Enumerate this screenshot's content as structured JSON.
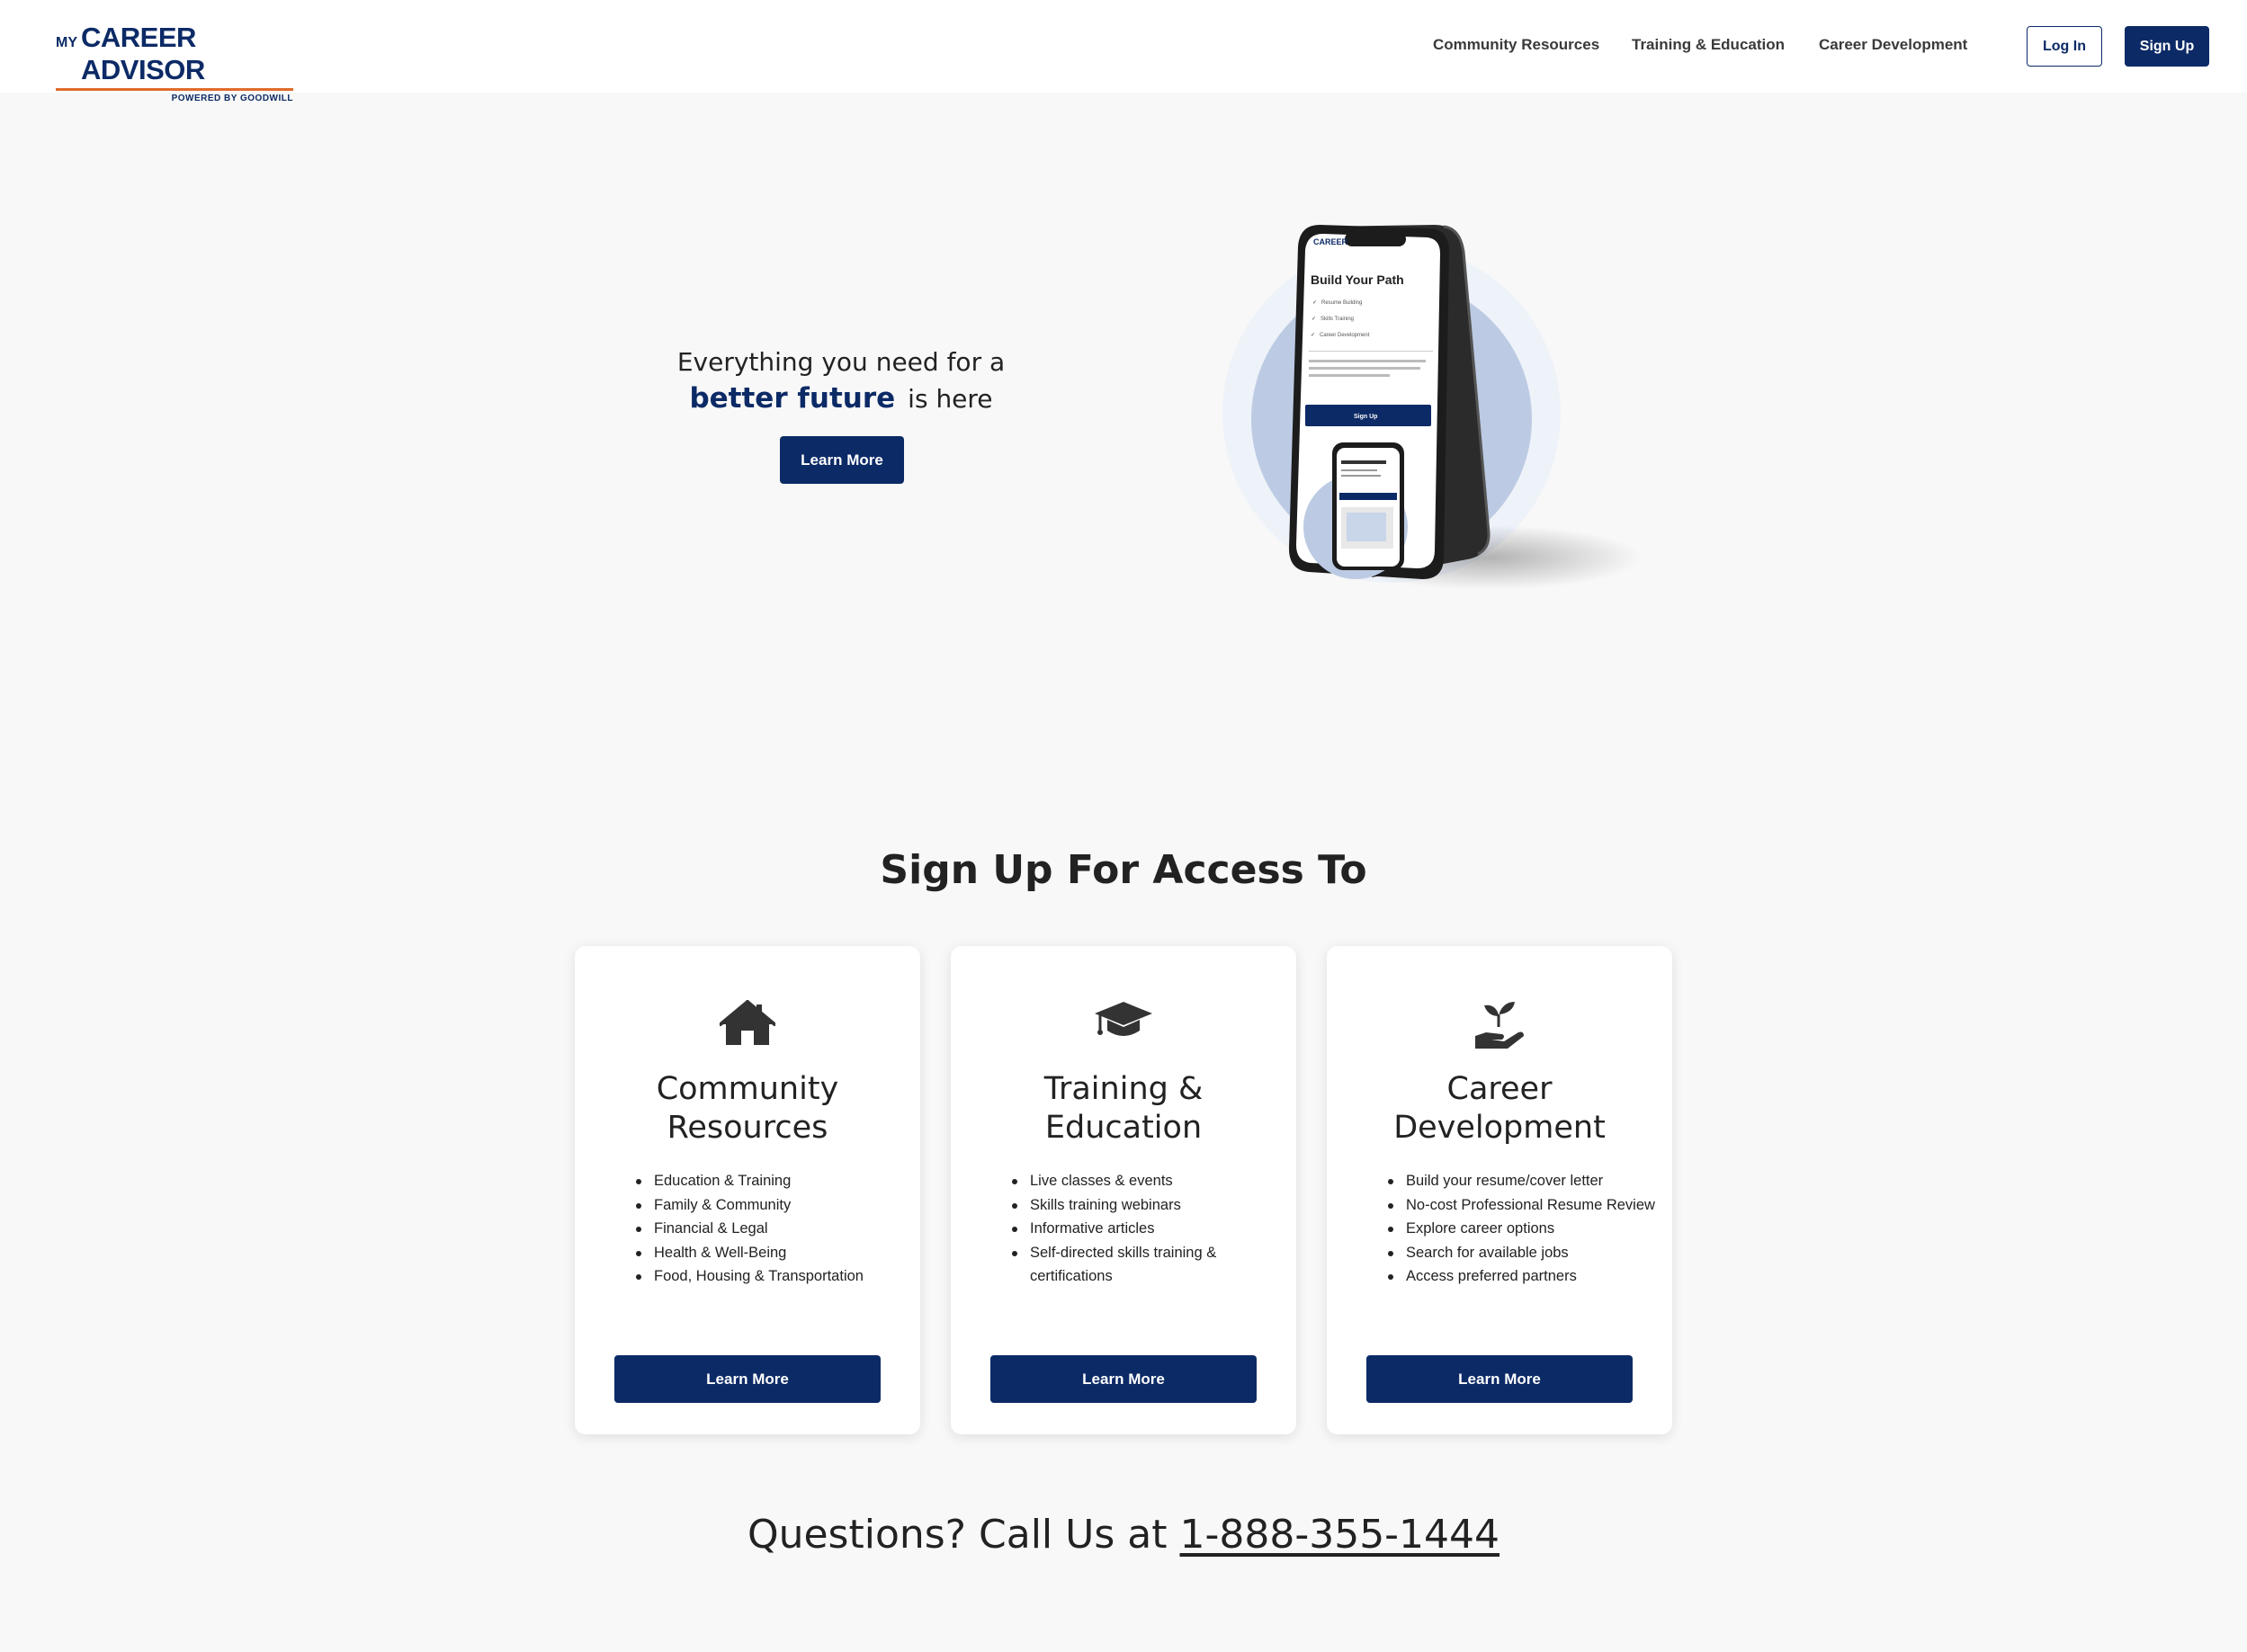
{
  "header": {
    "logo": {
      "my": "MY",
      "name": "CAREER ADVISOR",
      "powered_by": "POWERED BY GOODWILL"
    },
    "nav": [
      "Community Resources",
      "Training & Education",
      "Career Development"
    ],
    "login_label": "Log In",
    "signup_label": "Sign Up"
  },
  "hero": {
    "line1": "Everything you need for a",
    "highlight": "better future",
    "line2_rest": "is here",
    "button_label": "Learn More",
    "phone_screen": {
      "title": "Build Your Path",
      "checks": [
        "Resume Building",
        "Skills Training",
        "Career Development"
      ],
      "button": "Sign Up"
    }
  },
  "section_title": "Sign Up For Access To",
  "cards": [
    {
      "icon": "house-icon",
      "title": "Community Resources",
      "items": [
        "Education & Training",
        "Family & Community",
        "Financial & Legal",
        "Health & Well-Being",
        "Food, Housing & Transportation"
      ],
      "button_label": "Learn More"
    },
    {
      "icon": "graduation-cap-icon",
      "title": "Training & Education",
      "items": [
        "Live classes & events",
        "Skills training webinars",
        "Informative articles",
        "Self-directed skills training & certifications"
      ],
      "button_label": "Learn More"
    },
    {
      "icon": "hand-seedling-icon",
      "title": "Career Development",
      "items": [
        "Build your resume/cover letter",
        "No-cost Professional Resume Review",
        "Explore career options",
        "Search for available jobs",
        "Access preferred partners"
      ],
      "button_label": "Learn More"
    }
  ],
  "footer": {
    "questions_text": "Questions? Call Us at",
    "phone": "1-888-355-1444"
  },
  "colors": {
    "brand_navy": "#0c2a66",
    "accent_orange": "#e06a2a",
    "background": "#f8f8f8"
  }
}
